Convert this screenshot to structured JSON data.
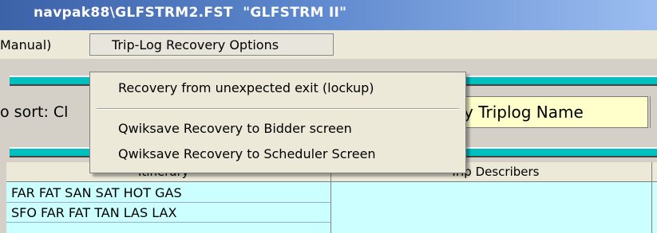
{
  "window": {
    "title": "navpak88\\GLFSTRM2.FST  \"GLFSTRM II\""
  },
  "menubar": {
    "manual_label": "Manual)",
    "trip_log_label": "Trip-Log Recovery Options"
  },
  "dropdown": {
    "items": [
      "Recovery from unexpected exit (lockup)",
      "Qwiksave Recovery to Bidder screen",
      "Qwiksave Recovery to Scheduler Screen"
    ]
  },
  "sort": {
    "label": "o sort: Cl",
    "field_value": "y Triplog Name"
  },
  "grid": {
    "headers": [
      "Itinerary",
      "Trip Describers"
    ],
    "rows": [
      "FAR FAT SAN SAT HOT GAS",
      "SFO FAR FAT TAN LAS LAX"
    ]
  }
}
